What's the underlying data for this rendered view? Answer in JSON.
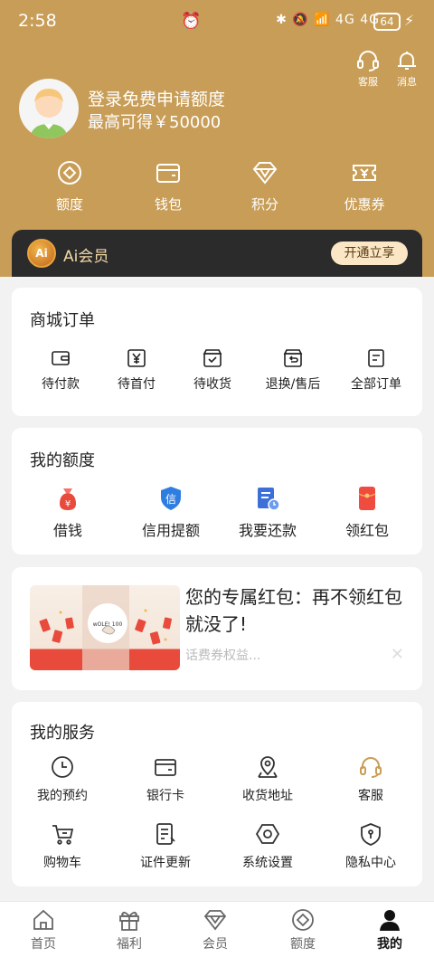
{
  "status_bar": {
    "time": "2:58",
    "battery": "64",
    "network_icons": "✱ 🔕 📶 4G 4G"
  },
  "top_actions": [
    {
      "label": "客服",
      "icon": "headset-icon"
    },
    {
      "label": "消息",
      "icon": "bell-icon"
    }
  ],
  "profile": {
    "line1": "登录免费申请额度",
    "line2": "最高可得￥50000"
  },
  "quick_actions": [
    {
      "label": "额度",
      "icon": "quota-icon"
    },
    {
      "label": "钱包",
      "icon": "wallet-icon"
    },
    {
      "label": "积分",
      "icon": "diamond-icon"
    },
    {
      "label": "优惠券",
      "icon": "coupon-icon"
    }
  ],
  "vip": {
    "badge": "Ai",
    "label": "Ai会员",
    "button": "开通立享"
  },
  "orders": {
    "title": "商城订单",
    "items": [
      {
        "label": "待付款",
        "icon": "wallet-small-icon"
      },
      {
        "label": "待首付",
        "icon": "yen-icon"
      },
      {
        "label": "待收货",
        "icon": "box-check-icon"
      },
      {
        "label": "退换/售后",
        "icon": "return-icon"
      },
      {
        "label": "全部订单",
        "icon": "document-icon"
      }
    ]
  },
  "quota": {
    "title": "我的额度",
    "items": [
      {
        "label": "借钱",
        "icon": "money-bag-icon"
      },
      {
        "label": "信用提额",
        "icon": "credit-shield-icon"
      },
      {
        "label": "我要还款",
        "icon": "repay-icon"
      },
      {
        "label": "领红包",
        "icon": "red-envelope-icon"
      }
    ]
  },
  "promo": {
    "title": "您的专属红包：再不领红包就没了!",
    "subtitle": "话费券权益...",
    "image_text": "wOLE! 100"
  },
  "services": {
    "title": "我的服务",
    "items": [
      {
        "label": "我的预约",
        "icon": "clock-icon"
      },
      {
        "label": "银行卡",
        "icon": "bank-card-icon"
      },
      {
        "label": "收货地址",
        "icon": "location-icon"
      },
      {
        "label": "客服",
        "icon": "headset-icon"
      },
      {
        "label": "购物车",
        "icon": "cart-icon"
      },
      {
        "label": "证件更新",
        "icon": "id-document-icon"
      },
      {
        "label": "系统设置",
        "icon": "settings-icon"
      },
      {
        "label": "隐私中心",
        "icon": "privacy-shield-icon"
      }
    ]
  },
  "tabbar": [
    {
      "label": "首页",
      "icon": "home-icon"
    },
    {
      "label": "福利",
      "icon": "gift-icon"
    },
    {
      "label": "会员",
      "icon": "diamond-icon"
    },
    {
      "label": "额度",
      "icon": "quota-icon"
    },
    {
      "label": "我的",
      "icon": "user-icon",
      "active": true
    }
  ],
  "colors": {
    "header": "#c89d57",
    "accent": "#c89d57",
    "vip_bar": "#2b2b2b",
    "red": "#e84a3c",
    "blue": "#2f7de1"
  }
}
